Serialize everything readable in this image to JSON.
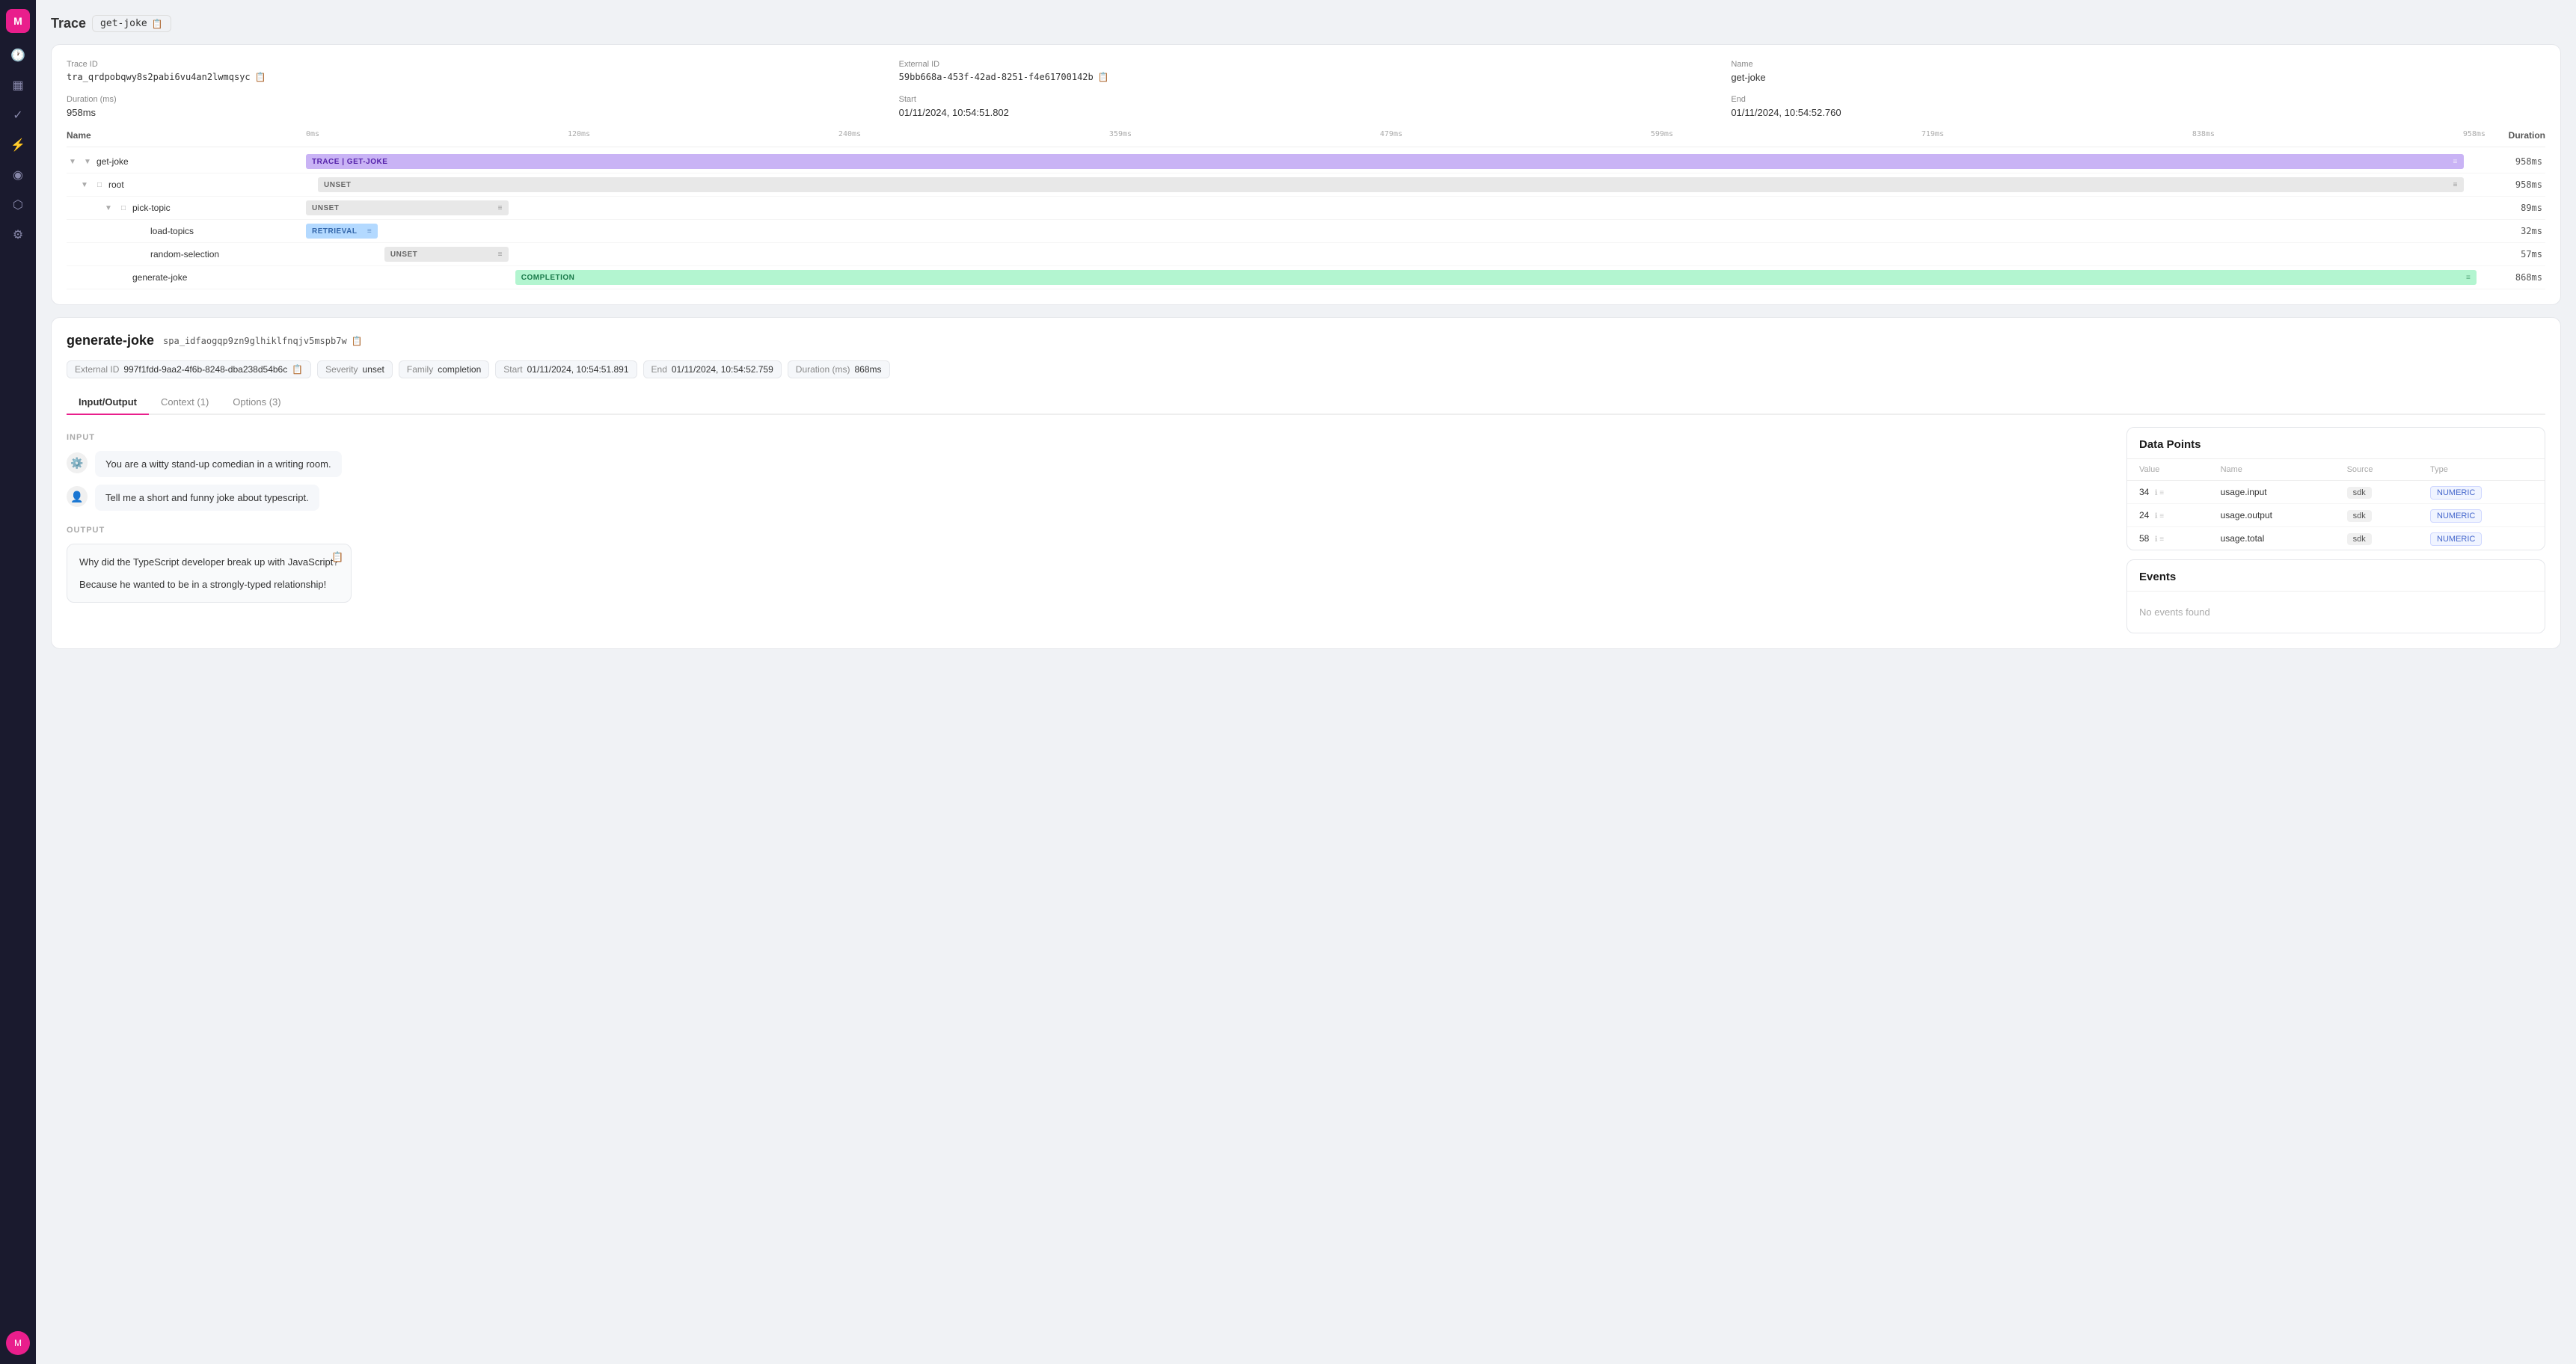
{
  "page": {
    "title": "Trace",
    "trace_name": "get-joke",
    "copy_icon": "📋"
  },
  "trace": {
    "id_label": "Trace ID",
    "id_value": "tra_qrdpobqwy8s2pabi6vu4an2lwmqsyc",
    "external_id_label": "External ID",
    "external_id_value": "59bb668a-453f-42ad-8251-f4e61700142b",
    "name_label": "Name",
    "name_value": "get-joke",
    "duration_label": "Duration (ms)",
    "duration_value": "958ms",
    "start_label": "Start",
    "start_value": "01/11/2024, 10:54:51.802",
    "end_label": "End",
    "end_value": "01/11/2024, 10:54:52.760"
  },
  "timeline": {
    "columns": {
      "name": "Name",
      "duration": "Duration"
    },
    "ticks": [
      "0ms",
      "120ms",
      "240ms",
      "359ms",
      "479ms",
      "599ms",
      "719ms",
      "838ms",
      "958ms"
    ],
    "spans": [
      {
        "id": "get-joke",
        "name": "get-joke",
        "indent": 0,
        "bar_label": "TRACE | GET-JOKE",
        "bar_color": "#c9b3f5",
        "bar_left_pct": 0,
        "bar_width_pct": 100,
        "duration": "958ms",
        "has_expand": true,
        "expanded": true
      },
      {
        "id": "root",
        "name": "root",
        "indent": 1,
        "bar_label": "UNSET",
        "bar_color": "#e8e8e8",
        "bar_left_pct": 0,
        "bar_width_pct": 100,
        "duration": "958ms",
        "has_expand": true,
        "expanded": true,
        "bar_text_color": "#666"
      },
      {
        "id": "pick-topic",
        "name": "pick-topic",
        "indent": 2,
        "bar_label": "UNSET",
        "bar_color": "#e8e8e8",
        "bar_left_pct": 0,
        "bar_width_pct": 9.3,
        "duration": "89ms",
        "has_expand": true,
        "expanded": true,
        "bar_text_color": "#666"
      },
      {
        "id": "load-topics",
        "name": "load-topics",
        "indent": 3,
        "bar_label": "RETRIEVAL",
        "bar_color": "#b3d9ff",
        "bar_left_pct": 0,
        "bar_width_pct": 3.3,
        "duration": "32ms",
        "has_expand": false,
        "bar_text_color": "#3366aa"
      },
      {
        "id": "random-selection",
        "name": "random-selection",
        "indent": 3,
        "bar_label": "UNSET",
        "bar_color": "#e8e8e8",
        "bar_left_pct": 3.5,
        "bar_width_pct": 5.9,
        "duration": "57ms",
        "has_expand": false,
        "bar_text_color": "#666"
      },
      {
        "id": "generate-joke",
        "name": "generate-joke",
        "indent": 2,
        "bar_label": "COMPLETION",
        "bar_color": "#b3f5d0",
        "bar_left_pct": 9.5,
        "bar_width_pct": 90.5,
        "duration": "868ms",
        "has_expand": false,
        "bar_text_color": "#1a7a4a"
      }
    ]
  },
  "span_detail": {
    "title": "generate-joke",
    "span_id": "spa_idfaogqp9zn9glhiklfnqjv5mspb7w",
    "external_id_label": "External ID",
    "external_id_value": "997f1fdd-9aa2-4f6b-8248-dba238d54b6c",
    "severity_label": "Severity",
    "severity_value": "unset",
    "family_label": "Family",
    "family_value": "completion",
    "start_label": "Start",
    "start_value": "01/11/2024, 10:54:51.891",
    "end_label": "End",
    "end_value": "01/11/2024, 10:54:52.759",
    "duration_label": "Duration (ms)",
    "duration_value": "868ms",
    "tabs": [
      {
        "label": "Input/Output",
        "active": true
      },
      {
        "label": "Context (1)",
        "active": false
      },
      {
        "label": "Options (3)",
        "active": false
      }
    ],
    "input_label": "INPUT",
    "messages": [
      {
        "type": "system",
        "icon": "⚙️",
        "text": "You are a witty stand-up comedian in a writing room."
      },
      {
        "type": "user",
        "icon": "👤",
        "text": "Tell me a short and funny joke about typescript."
      }
    ],
    "output_label": "OUTPUT",
    "output_text": "Why did the TypeScript developer break up with JavaScript?\n\nBecause he wanted to be in a strongly-typed relationship!"
  },
  "data_points": {
    "title": "Data Points",
    "columns": [
      "Value",
      "Name",
      "Source",
      "Type"
    ],
    "rows": [
      {
        "value": "34",
        "name": "usage.input",
        "source": "sdk",
        "type": "NUMERIC"
      },
      {
        "value": "24",
        "name": "usage.output",
        "source": "sdk",
        "type": "NUMERIC"
      },
      {
        "value": "58",
        "name": "usage.total",
        "source": "sdk",
        "type": "NUMERIC"
      }
    ]
  },
  "events": {
    "title": "Events",
    "empty_text": "No events found"
  },
  "sidebar": {
    "logo_letter": "M",
    "items": [
      {
        "icon": "🕐",
        "name": "history",
        "active": false
      },
      {
        "icon": "▦",
        "name": "grid",
        "active": false
      },
      {
        "icon": "✓",
        "name": "check",
        "active": false
      },
      {
        "icon": "⚡",
        "name": "lightning",
        "active": false
      },
      {
        "icon": "◎",
        "name": "circle-dots",
        "active": false
      },
      {
        "icon": "⬡",
        "name": "hexagon",
        "active": false
      },
      {
        "icon": "⚙",
        "name": "settings",
        "active": false
      }
    ],
    "avatar_initials": "M"
  }
}
